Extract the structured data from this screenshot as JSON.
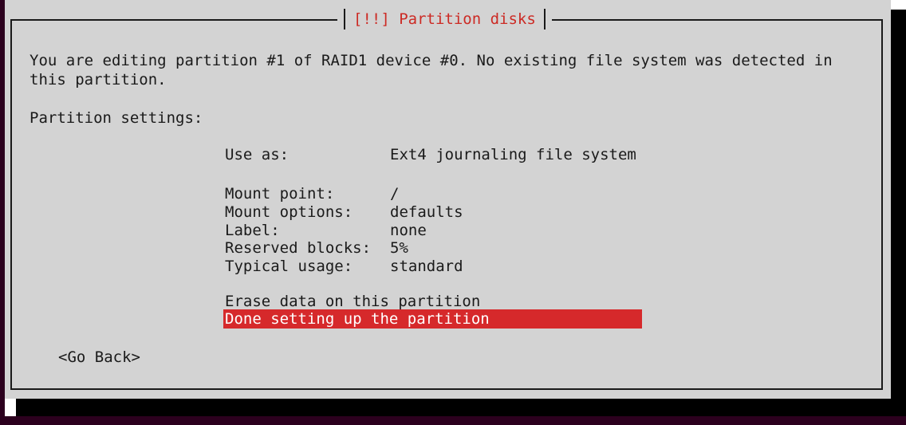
{
  "dialog": {
    "title": "[!!] Partition disks",
    "description_line1": "You are editing partition #1 of RAID1 device #0. No existing file system was detected in",
    "description_line2": "this partition.",
    "settings_header": "Partition settings:"
  },
  "settings": [
    {
      "label": "Use as:",
      "value": "Ext4 journaling file system"
    },
    {
      "label": "Mount point:",
      "value": "/"
    },
    {
      "label": "Mount options:",
      "value": "defaults"
    },
    {
      "label": "Label:",
      "value": "none"
    },
    {
      "label": "Reserved blocks:",
      "value": "5%"
    },
    {
      "label": "Typical usage:",
      "value": "standard"
    }
  ],
  "actions": [
    {
      "label": "Erase data on this partition",
      "selected": false
    },
    {
      "label": "Done setting up the partition",
      "selected": true
    }
  ],
  "buttons": {
    "go_back": "<Go Back>"
  },
  "colors": {
    "dialog_bg": "#d3d3d3",
    "title_text": "#cc2a24",
    "highlight_bg": "#d6292b",
    "highlight_text": "#ffffff",
    "terminal_bg": "#2c001e"
  }
}
